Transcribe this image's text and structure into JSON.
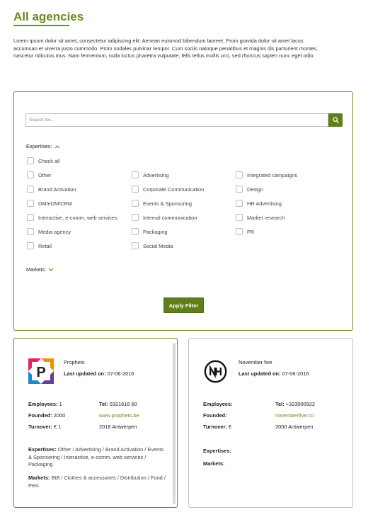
{
  "page": {
    "title": "All agencies",
    "intro": "Lorem ipsum dolor sit amet, consectetur adipiscing elit. Aenean euismod bibendum laoreet. Proin gravida dolor sit amet lacus accumsan et viverra justo commodo. Proin sodales pulvinar tempor. Cum sociis natoque penatibus et magnis dis parturient montes, nascetur ridiculus mus. Nam fermentum, nulla luctus pharetra vulputate, felis tellus mollis orci, sed rhoncus sapien nunc eget odio."
  },
  "filter": {
    "search_placeholder": "Search for...",
    "expertises_label": "Expertises:",
    "check_all": "Check all",
    "col1": [
      "Other",
      "Brand Activation",
      "DM/eDM/CRM",
      "Interactive, e-comm, web services",
      "Media agency",
      "Retail"
    ],
    "col2": [
      "Advertising",
      "Corporate Communication",
      "Events & Sponsoring",
      "Internal communication",
      "Packaging",
      "Social Media"
    ],
    "col3": [
      "Integrated campaigns",
      "Design",
      "HR Advertising",
      "Market research",
      "PR"
    ],
    "markets_label": "Markets:",
    "apply_label": "Apply Filter"
  },
  "labels": {
    "last_updated": "Last updated on:",
    "employees": "Employees:",
    "founded": "Founded:",
    "turnover": "Turnover:",
    "tel": "Tel:",
    "expertises": "Expertises:",
    "markets": "Markets:"
  },
  "cards": [
    {
      "name": "Prophets",
      "updated": "07-06-2016",
      "employees": "1",
      "founded": "2000",
      "turnover": "€ 1",
      "tel": "0321616 60",
      "website": "www.prophets.be",
      "location": "2018 Antwerpen",
      "expertises": "Other / Advertising / Brand Activation / Events & Sponsoring / Interactive, e-comm, web services / Packaging",
      "markets": "BtB / Clothes & accessoires / Distribution / Food / Pets"
    },
    {
      "name": "November five",
      "updated": "07-06-2016",
      "employees": "",
      "founded": "",
      "turnover": "€",
      "tel": "+323500922",
      "website": "novemberfive.co",
      "location": "2000 Antwerpen",
      "expertises": "",
      "markets": ""
    }
  ],
  "colors": {
    "accent": "#6b8a1f",
    "button": "#5f7f1a",
    "border": "#bfbfbf"
  },
  "icons": {
    "search": "search-icon",
    "expand_up": "chevron-up-icon",
    "expand_down": "chevron-down-icon",
    "logo_1": "prophets-logo",
    "logo_2": "november-five-logo"
  }
}
